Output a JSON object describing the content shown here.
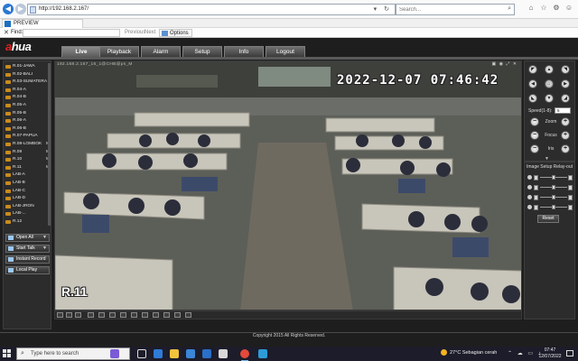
{
  "browser": {
    "url": "http://192.168.2.167/",
    "search_placeholder": "Search...",
    "tab_label": "PREVIEW",
    "find": {
      "label": "Find:",
      "value": "",
      "prev": "Previous",
      "next": "Next",
      "options": "Options"
    }
  },
  "app": {
    "logo_a": "a",
    "logo_rest": "hua",
    "nav": [
      "Live",
      "Playback",
      "Alarm",
      "Setup",
      "Info",
      "Logout"
    ],
    "active_nav": "Live",
    "cameras": [
      {
        "label": "R.01-JAWA",
        "m": ""
      },
      {
        "label": "R.02-BALI",
        "m": ""
      },
      {
        "label": "R.03-SUMATERA",
        "m": ""
      },
      {
        "label": "R.04-A",
        "m": ""
      },
      {
        "label": "R.04-B",
        "m": ""
      },
      {
        "label": "R.05-A",
        "m": ""
      },
      {
        "label": "R.05-B",
        "m": ""
      },
      {
        "label": "R.06-A",
        "m": ""
      },
      {
        "label": "R.06-B",
        "m": ""
      },
      {
        "label": "R.07-PAPUA",
        "m": ""
      },
      {
        "label": "R.08-LOMBOK",
        "m": "M"
      },
      {
        "label": "R.09",
        "m": "M"
      },
      {
        "label": "R.10",
        "m": "M"
      },
      {
        "label": "R.11",
        "m": "M"
      },
      {
        "label": "LAB-A",
        "m": ""
      },
      {
        "label": "LAB-B",
        "m": ""
      },
      {
        "label": "LAB-C",
        "m": ""
      },
      {
        "label": "LAB-D",
        "m": ""
      },
      {
        "label": "LAB-JRON",
        "m": ""
      },
      {
        "label": "LAB-...",
        "m": ""
      },
      {
        "label": "R.12",
        "m": ""
      }
    ],
    "actions": [
      "Open All",
      "Start Talk",
      "Instant Record",
      "Local Play"
    ],
    "video": {
      "info": "192.168.2.167_16_1@CHB@ps_M",
      "timestamp": "2022-12-07 07:46:42",
      "camera_label": "R.11"
    },
    "ptz": {
      "speed_label": "Speed(1-8):",
      "speed_value": "5",
      "zoom": "Zoom",
      "focus": "Focus",
      "iris": "Iris",
      "minus": "−",
      "plus": "+"
    },
    "image_setup": {
      "title": "Image Setup",
      "relay": "Relay-out",
      "reset": "Reset"
    },
    "copyright": "Copyright 2015 All Rights Reserved."
  },
  "taskbar": {
    "search_placeholder": "Type here to search",
    "weather": "27°C  Sebagian cerah",
    "time": "07:47",
    "date": "12/07/2022"
  }
}
